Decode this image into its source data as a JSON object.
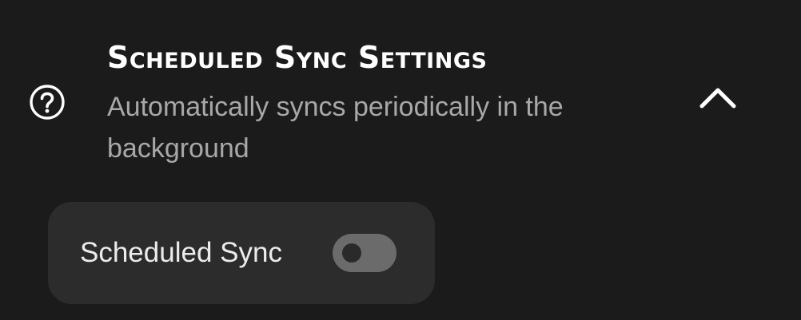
{
  "settings_section": {
    "title": "Scheduled Sync Settings",
    "description": "Automatically syncs periodically in the background",
    "help_icon": "question-circle-icon",
    "collapse_icon": "chevron-up-icon",
    "expanded": true
  },
  "scheduled_sync_setting": {
    "label": "Scheduled Sync",
    "enabled": false
  },
  "colors": {
    "background": "#1b1b1b",
    "card": "#2c2c2c",
    "title": "#ffffff",
    "description": "#a8a8a8",
    "toggle_track_off": "#6b6b6b",
    "toggle_knob_off": "#2a2a2a"
  }
}
